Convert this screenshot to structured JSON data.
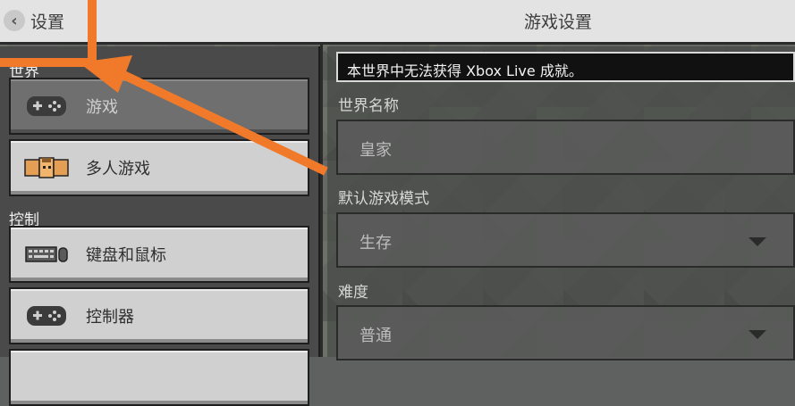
{
  "topbar": {
    "back_label": "设置",
    "title": "游戏设置"
  },
  "left": {
    "sections": [
      {
        "label": "世界"
      },
      {
        "label": "控制"
      }
    ],
    "items": [
      {
        "label": "游戏",
        "icon": "controller-icon",
        "active": true
      },
      {
        "label": "多人游戏",
        "icon": "players-icon",
        "active": false
      },
      {
        "label": "键盘和鼠标",
        "icon": "keyboard-mouse-icon",
        "active": false
      },
      {
        "label": "控制器",
        "icon": "controller-icon",
        "active": false
      }
    ]
  },
  "right": {
    "notice": "本世界中无法获得 Xbox Live 成就。",
    "world_name_label": "世界名称",
    "world_name_value": "皇家",
    "game_mode_label": "默认游戏模式",
    "game_mode_value": "生存",
    "difficulty_label": "难度",
    "difficulty_value": "普通"
  },
  "colors": {
    "annotation": "#f07a2a"
  }
}
